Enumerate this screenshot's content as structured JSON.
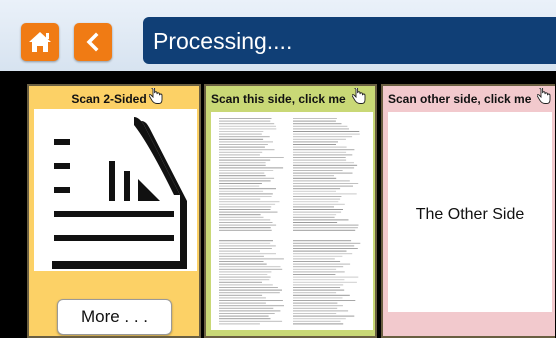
{
  "header": {
    "title": "Processing....",
    "home_icon": "home-icon",
    "back_icon": "chevron-left-icon",
    "accent": "#f07b14",
    "title_bg": "#103f76"
  },
  "panels": [
    {
      "label": "Scan 2-Sided",
      "icon": "two-sided-document-icon",
      "button": "More . . .",
      "bg": "#fcd166"
    },
    {
      "label": "Scan this side, click me",
      "icon": "scanned-page-preview",
      "bg": "#c9d876"
    },
    {
      "label": "Scan other side, click me",
      "content": "The Other Side",
      "bg": "#f2c9cd"
    }
  ]
}
